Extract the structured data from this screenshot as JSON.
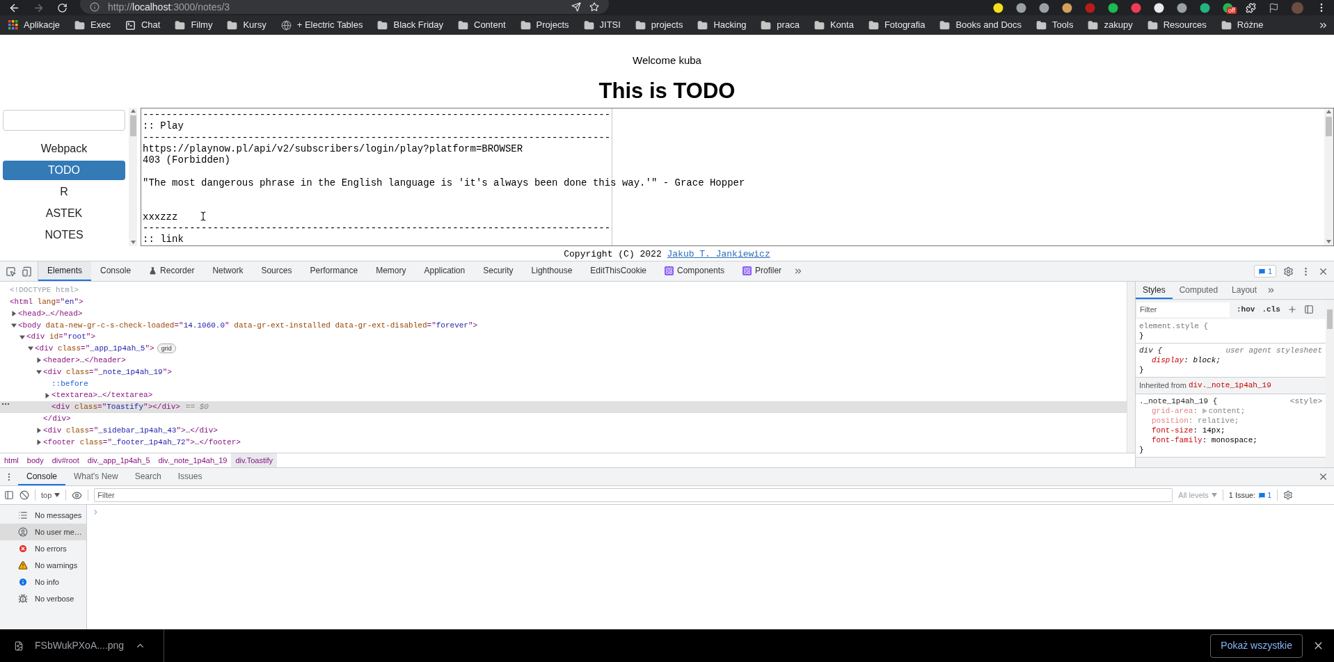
{
  "browser": {
    "url": {
      "scheme": "http://",
      "host": "localhost",
      "path": ":3000/notes/3"
    },
    "extension_badge": "off",
    "bookmarks": [
      {
        "kind": "apps",
        "label": "Aplikacje"
      },
      {
        "kind": "folder",
        "label": "Exec"
      },
      {
        "kind": "terminal",
        "label": "Chat"
      },
      {
        "kind": "folder",
        "label": "Filmy"
      },
      {
        "kind": "folder",
        "label": "Kursy"
      },
      {
        "kind": "globe",
        "label": "+ Electric Tables"
      },
      {
        "kind": "folder",
        "label": "Black Friday"
      },
      {
        "kind": "folder",
        "label": "Content"
      },
      {
        "kind": "folder",
        "label": "Projects"
      },
      {
        "kind": "folder",
        "label": "JITSI"
      },
      {
        "kind": "folder",
        "label": "projects"
      },
      {
        "kind": "folder",
        "label": "Hacking"
      },
      {
        "kind": "folder",
        "label": "praca"
      },
      {
        "kind": "folder",
        "label": "Konta"
      },
      {
        "kind": "folder",
        "label": "Fotografia"
      },
      {
        "kind": "folder",
        "label": "Books and Docs"
      },
      {
        "kind": "folder",
        "label": "Tools"
      },
      {
        "kind": "folder",
        "label": "zakupy"
      },
      {
        "kind": "folder",
        "label": "Resources"
      },
      {
        "kind": "folder",
        "label": "Różne"
      }
    ]
  },
  "page": {
    "welcome": "Welcome kuba",
    "title": "This is TODO",
    "sidebar": {
      "items": [
        {
          "label": "Webpack",
          "selected": false
        },
        {
          "label": "TODO",
          "selected": true
        },
        {
          "label": "R",
          "selected": false
        },
        {
          "label": "ASTEK",
          "selected": false
        },
        {
          "label": "NOTES",
          "selected": false
        }
      ]
    },
    "note": "--------------------------------------------------------------------------------\n:: Play\n--------------------------------------------------------------------------------\nhttps://playnow.pl/api/v2/subscribers/login/play?platform=BROWSER\n403 (Forbidden)\n\n\"The most dangerous phrase in the English language is 'it's always been done this way.'\" - Grace Hopper\n\n\nxxxzzz\n--------------------------------------------------------------------------------\n:: link",
    "footer": {
      "text": "Copyright (C) 2022 ",
      "link": "Jakub T. Jankiewicz"
    }
  },
  "devtools": {
    "tabs": [
      {
        "label": "Elements",
        "kind": "plain",
        "selected": true
      },
      {
        "label": "Console",
        "kind": "plain",
        "selected": false
      },
      {
        "label": "Recorder",
        "kind": "flask",
        "selected": false
      },
      {
        "label": "Network",
        "kind": "plain",
        "selected": false
      },
      {
        "label": "Sources",
        "kind": "plain",
        "selected": false
      },
      {
        "label": "Performance",
        "kind": "plain",
        "selected": false
      },
      {
        "label": "Memory",
        "kind": "plain",
        "selected": false
      },
      {
        "label": "Application",
        "kind": "plain",
        "selected": false
      },
      {
        "label": "Security",
        "kind": "plain",
        "selected": false
      },
      {
        "label": "Lighthouse",
        "kind": "plain",
        "selected": false
      },
      {
        "label": "EditThisCookie",
        "kind": "plain",
        "selected": false
      },
      {
        "label": "Components",
        "kind": "react",
        "selected": false
      },
      {
        "label": "Profiler",
        "kind": "react",
        "selected": false
      }
    ],
    "issues_badge": "1",
    "tree": [
      {
        "kind": "plain",
        "selected": false,
        "segments": [
          {
            "kind": "comment",
            "text": "<!DOCTYPE html>"
          }
        ]
      },
      {
        "kind": "plain",
        "selected": false,
        "segments": [
          {
            "kind": "tag",
            "text": "<html "
          },
          {
            "kind": "attr",
            "text": "lang"
          },
          {
            "kind": "tag",
            "text": "=\""
          },
          {
            "kind": "value",
            "text": "en"
          },
          {
            "kind": "tag",
            "text": "\">"
          }
        ],
        "children": [
          {
            "kind": "toggle",
            "expanded": false,
            "selected": false,
            "segments": [
              {
                "kind": "tag",
                "text": "<head>"
              },
              {
                "kind": "ellipsis",
                "text": "…"
              },
              {
                "kind": "tag",
                "text": "</head>"
              }
            ]
          },
          {
            "kind": "toggle",
            "expanded": true,
            "selected": false,
            "segments": [
              {
                "kind": "tag",
                "text": "<body "
              },
              {
                "kind": "attr",
                "text": "data-new-gr-c-s-check-loaded"
              },
              {
                "kind": "tag",
                "text": "=\""
              },
              {
                "kind": "value",
                "text": "14.1060.0"
              },
              {
                "kind": "tag",
                "text": "\" "
              },
              {
                "kind": "attr",
                "text": "data-gr-ext-installed data-gr-ext-disabled"
              },
              {
                "kind": "tag",
                "text": "=\""
              },
              {
                "kind": "value",
                "text": "forever"
              },
              {
                "kind": "tag",
                "text": "\">"
              }
            ],
            "children": [
              {
                "kind": "toggle",
                "expanded": true,
                "selected": false,
                "segments": [
                  {
                    "kind": "tag",
                    "text": "<div "
                  },
                  {
                    "kind": "attr",
                    "text": "id"
                  },
                  {
                    "kind": "tag",
                    "text": "=\""
                  },
                  {
                    "kind": "value",
                    "text": "root"
                  },
                  {
                    "kind": "tag",
                    "text": "\">"
                  }
                ],
                "children": [
                  {
                    "kind": "toggle",
                    "expanded": true,
                    "selected": false,
                    "segments": [
                      {
                        "kind": "tag",
                        "text": "<div "
                      },
                      {
                        "kind": "attr",
                        "text": "class"
                      },
                      {
                        "kind": "tag",
                        "text": "=\""
                      },
                      {
                        "kind": "value",
                        "text": "_app_1p4ah_5"
                      },
                      {
                        "kind": "tag",
                        "text": "\">"
                      },
                      {
                        "kind": "badge",
                        "text": "grid"
                      }
                    ],
                    "children": [
                      {
                        "kind": "toggle",
                        "expanded": false,
                        "selected": false,
                        "segments": [
                          {
                            "kind": "tag",
                            "text": "<header>"
                          },
                          {
                            "kind": "ellipsis",
                            "text": "…"
                          },
                          {
                            "kind": "tag",
                            "text": "</header>"
                          }
                        ]
                      },
                      {
                        "kind": "toggle",
                        "expanded": true,
                        "selected": false,
                        "segments": [
                          {
                            "kind": "tag",
                            "text": "<div "
                          },
                          {
                            "kind": "attr",
                            "text": "class"
                          },
                          {
                            "kind": "tag",
                            "text": "=\""
                          },
                          {
                            "kind": "value",
                            "text": "_note_1p4ah_19"
                          },
                          {
                            "kind": "tag",
                            "text": "\">"
                          }
                        ],
                        "closing": [
                          {
                            "kind": "tag",
                            "text": "</div>"
                          }
                        ],
                        "children": [
                          {
                            "kind": "plain",
                            "selected": false,
                            "segments": [
                              {
                                "kind": "pseudo",
                                "text": "::before"
                              }
                            ]
                          },
                          {
                            "kind": "toggle",
                            "expanded": false,
                            "selected": false,
                            "segments": [
                              {
                                "kind": "tag",
                                "text": "<textarea>"
                              },
                              {
                                "kind": "ellipsis",
                                "text": "…"
                              },
                              {
                                "kind": "tag",
                                "text": "</textarea>"
                              }
                            ]
                          },
                          {
                            "kind": "plain",
                            "selected": true,
                            "segments": [
                              {
                                "kind": "tag",
                                "text": "<div "
                              },
                              {
                                "kind": "attr",
                                "text": "class"
                              },
                              {
                                "kind": "tag",
                                "text": "=\""
                              },
                              {
                                "kind": "value",
                                "text": "Toastify"
                              },
                              {
                                "kind": "tag",
                                "text": "\"></div>"
                              },
                              {
                                "kind": "hint",
                                "text": "== $0"
                              }
                            ]
                          }
                        ]
                      },
                      {
                        "kind": "toggle",
                        "expanded": false,
                        "selected": false,
                        "segments": [
                          {
                            "kind": "tag",
                            "text": "<div "
                          },
                          {
                            "kind": "attr",
                            "text": "class"
                          },
                          {
                            "kind": "tag",
                            "text": "=\""
                          },
                          {
                            "kind": "value",
                            "text": "_sidebar_1p4ah_43"
                          },
                          {
                            "kind": "tag",
                            "text": "\">"
                          },
                          {
                            "kind": "ellipsis",
                            "text": "…"
                          },
                          {
                            "kind": "tag",
                            "text": "</div>"
                          }
                        ]
                      },
                      {
                        "kind": "toggle",
                        "expanded": false,
                        "selected": false,
                        "segments": [
                          {
                            "kind": "tag",
                            "text": "<footer "
                          },
                          {
                            "kind": "attr",
                            "text": "class"
                          },
                          {
                            "kind": "tag",
                            "text": "=\""
                          },
                          {
                            "kind": "value",
                            "text": "_footer_1p4ah_72"
                          },
                          {
                            "kind": "tag",
                            "text": "\">"
                          },
                          {
                            "kind": "ellipsis",
                            "text": "…"
                          },
                          {
                            "kind": "tag",
                            "text": "</footer>"
                          }
                        ]
                      }
                    ]
                  }
                ]
              }
            ]
          }
        ]
      }
    ],
    "breadcrumbs": [
      {
        "label": "html",
        "selected": false
      },
      {
        "label": "body",
        "selected": false
      },
      {
        "label": "div#root",
        "selected": false
      },
      {
        "label": "div._app_1p4ah_5",
        "selected": false
      },
      {
        "label": "div._note_1p4ah_19",
        "selected": false
      },
      {
        "label": "div.Toastify",
        "selected": true
      }
    ],
    "styles": {
      "tabs": [
        {
          "label": "Styles",
          "selected": true
        },
        {
          "label": "Computed",
          "selected": false
        },
        {
          "label": "Layout",
          "selected": false
        }
      ],
      "filter_placeholder": "Filter",
      "buttons": [
        ":hov",
        ".cls"
      ],
      "separator": ": ",
      "sections": [
        {
          "kind": "rule",
          "selector": "element.style",
          "muted": true,
          "italic": false,
          "open": " {",
          "close": "}"
        },
        {
          "kind": "rule",
          "selector": "div",
          "muted": false,
          "italic": true,
          "open": " {",
          "source": "user agent stylesheet",
          "close": "}",
          "properties": [
            {
              "name": "display",
              "value": "block;",
              "inactive": false,
              "expandable": false
            }
          ]
        },
        {
          "kind": "inherited",
          "label": "Inherited from ",
          "selector": "div._note_1p4ah_19"
        },
        {
          "kind": "rule",
          "selector": "._note_1p4ah_19",
          "muted": false,
          "italic": false,
          "open": " {",
          "source": "<style>",
          "close": "}",
          "properties": [
            {
              "name": "grid-area",
              "value": "content;",
              "inactive": true,
              "expandable": true
            },
            {
              "name": "position",
              "value": "relative;",
              "inactive": true,
              "expandable": false
            },
            {
              "name": "font-size",
              "value": "14px;",
              "inactive": false,
              "expandable": false
            },
            {
              "name": "font-family",
              "value": "monospace;",
              "inactive": false,
              "expandable": false
            }
          ]
        }
      ]
    }
  },
  "drawer": {
    "tabs": [
      {
        "label": "Console",
        "selected": true
      },
      {
        "label": "What's New",
        "selected": false
      },
      {
        "label": "Search",
        "selected": false
      },
      {
        "label": "Issues",
        "selected": false
      }
    ],
    "context": "top",
    "filter_placeholder": "Filter",
    "levels": "All levels",
    "issues_label": "1 Issue:",
    "issues_count": "1",
    "sidebar": [
      {
        "kind": "messages",
        "label": "No messages",
        "selected": false
      },
      {
        "kind": "user",
        "label": "No user me…",
        "selected": true
      },
      {
        "kind": "errors",
        "label": "No errors",
        "selected": false
      },
      {
        "kind": "warnings",
        "label": "No warnings",
        "selected": false
      },
      {
        "kind": "info",
        "label": "No info",
        "selected": false
      },
      {
        "kind": "verbose",
        "label": "No verbose",
        "selected": false
      }
    ]
  },
  "downloads": {
    "filename": "FSbWukPXoA....png",
    "show_all": "Pokaż wszystkie"
  }
}
